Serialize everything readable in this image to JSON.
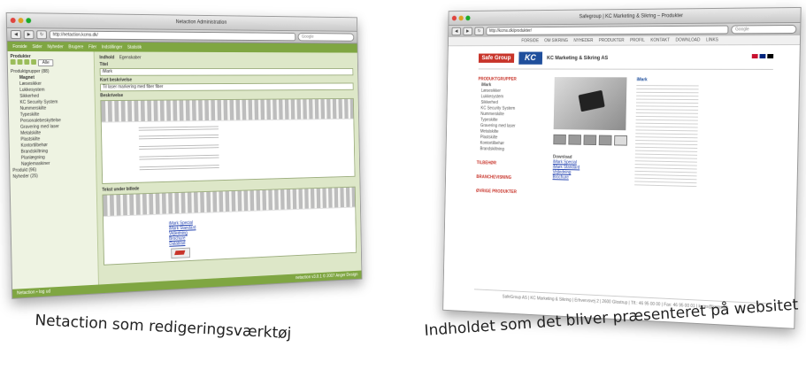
{
  "left_screenshot": {
    "window_title": "Netaction Administration",
    "url": "http://netaction.kcms.dk/",
    "search_placeholder": "Google",
    "nav_items": [
      "Forside",
      "Sider",
      "Nyheder",
      "Brugere",
      "Filer",
      "Indstillinger",
      "Statistik"
    ],
    "tree_title": "Produkter",
    "tree_select": "Alle",
    "tree_nodes": [
      "Produktgrupper (88)",
      "Magnet",
      "Læsesikker",
      "Lukkesystem",
      "Sikkerhed",
      "KC Security System",
      "Nummerskilte",
      "Typeskilte",
      "Personalebeskyttelse",
      "Gravering med laser",
      "Metalskilte",
      "Plastskilte",
      "Kontortilbehør",
      "Brandskiltning",
      "Planlægning",
      "Nøglemaskiner",
      "Produkt (96)",
      "Nyheder (25)"
    ],
    "tabs": [
      "Indhold",
      "Egenskaber"
    ],
    "title_label": "Titel",
    "title_value": "iMark",
    "short_label": "Kort beskrivelse",
    "short_value": "Til laser markering med fiber fiber",
    "body_label": "Beskrivelse",
    "footer_label": "Tekst under billede",
    "links": [
      "iMark Special",
      "iMark Standard",
      "Vejledning",
      "Brochure",
      "Datablad"
    ],
    "status_left": "Netaction • log ud",
    "status_right": "netaction v3.0.1 © 2007 Anger Design"
  },
  "right_screenshot": {
    "window_title": "Safegroup | KC Marketing & Sikring – Produkter",
    "url": "http://kcms.dk/produkter/",
    "search_placeholder": "Google",
    "top_nav": [
      "FORSIDE",
      "OM SIKRING",
      "NYHEDER",
      "PRODUKTER",
      "PROFIL",
      "KONTAKT",
      "DOWNLOAD",
      "LINKS"
    ],
    "brand_safegroup": "Safe Group",
    "brand_kc": "KC",
    "brand_name": "KC Marketing & Sikring AS",
    "menu_head_1": "PRODUKTGRUPPER",
    "menu_items": [
      "iMark",
      "Læsesikker",
      "Lukkesystem",
      "Sikkerhed",
      "KC Security System",
      "Nummerskilte",
      "Typeskilte",
      "Gravering med laser",
      "Metalskilte",
      "Plastskilte",
      "Kontortilbehør",
      "Brandskiltning"
    ],
    "menu_head_2": "TILBEHØR",
    "menu_head_3": "BRANCHEVISNING",
    "menu_head_4": "ØVRIGE PRODUKTER",
    "product_heading": "iMark",
    "download_heading": "Download",
    "links": [
      "iMark Special",
      "iMark Standard",
      "Vejledning",
      "Brochure"
    ],
    "footer": "SafeGroup AS | KC Marketing & Sikring | Erhvervsvej 2 | 2600 Glostrup | Tlf.: 46 95 00 00 | Fax: 46 95 00 01 | kcms@kcms.dk"
  },
  "captions": {
    "left": "Netaction som redigeringsværktøj",
    "right": "Indholdet som det bliver præsenteret på websitet"
  }
}
